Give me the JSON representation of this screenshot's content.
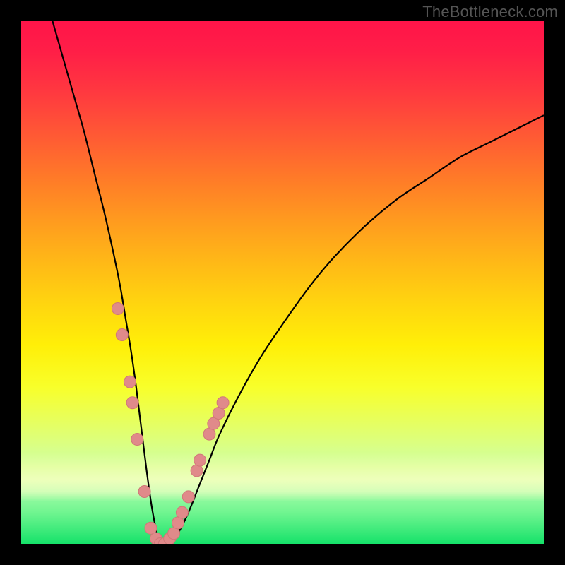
{
  "attribution": "TheBottleneck.com",
  "colors": {
    "curve_stroke": "#000000",
    "marker_fill": "#e08a8a",
    "marker_stroke": "#d07878",
    "frame": "#000000"
  },
  "chart_data": {
    "type": "line",
    "title": "",
    "xlabel": "",
    "ylabel": "",
    "xlim": [
      0,
      100
    ],
    "ylim": [
      0,
      100
    ],
    "series": [
      {
        "name": "bottleneck-curve",
        "x": [
          6,
          8,
          10,
          12,
          14,
          16,
          18,
          19,
          20,
          21,
          22,
          23,
          24,
          25,
          26,
          27,
          28,
          29,
          30,
          32,
          34,
          36,
          38,
          42,
          46,
          50,
          55,
          60,
          66,
          72,
          78,
          84,
          90,
          96,
          100
        ],
        "y": [
          100,
          93,
          86,
          79,
          71,
          63,
          54,
          49,
          43,
          37,
          30,
          22,
          14,
          7,
          2,
          0,
          0,
          1,
          2,
          6,
          11,
          16,
          21,
          29,
          36,
          42,
          49,
          55,
          61,
          66,
          70,
          74,
          77,
          80,
          82
        ]
      }
    ],
    "markers": [
      {
        "x": 18.5,
        "y": 45
      },
      {
        "x": 19.3,
        "y": 40
      },
      {
        "x": 20.8,
        "y": 31
      },
      {
        "x": 21.3,
        "y": 27
      },
      {
        "x": 22.2,
        "y": 20
      },
      {
        "x": 23.6,
        "y": 10
      },
      {
        "x": 24.8,
        "y": 3
      },
      {
        "x": 25.8,
        "y": 1
      },
      {
        "x": 26.6,
        "y": 0
      },
      {
        "x": 27.4,
        "y": 0
      },
      {
        "x": 28.4,
        "y": 1
      },
      {
        "x": 29.2,
        "y": 2
      },
      {
        "x": 30.0,
        "y": 4
      },
      {
        "x": 30.8,
        "y": 6
      },
      {
        "x": 32.0,
        "y": 9
      },
      {
        "x": 33.6,
        "y": 14
      },
      {
        "x": 34.2,
        "y": 16
      },
      {
        "x": 36.0,
        "y": 21
      },
      {
        "x": 36.8,
        "y": 23
      },
      {
        "x": 37.8,
        "y": 25
      },
      {
        "x": 38.6,
        "y": 27
      }
    ]
  }
}
